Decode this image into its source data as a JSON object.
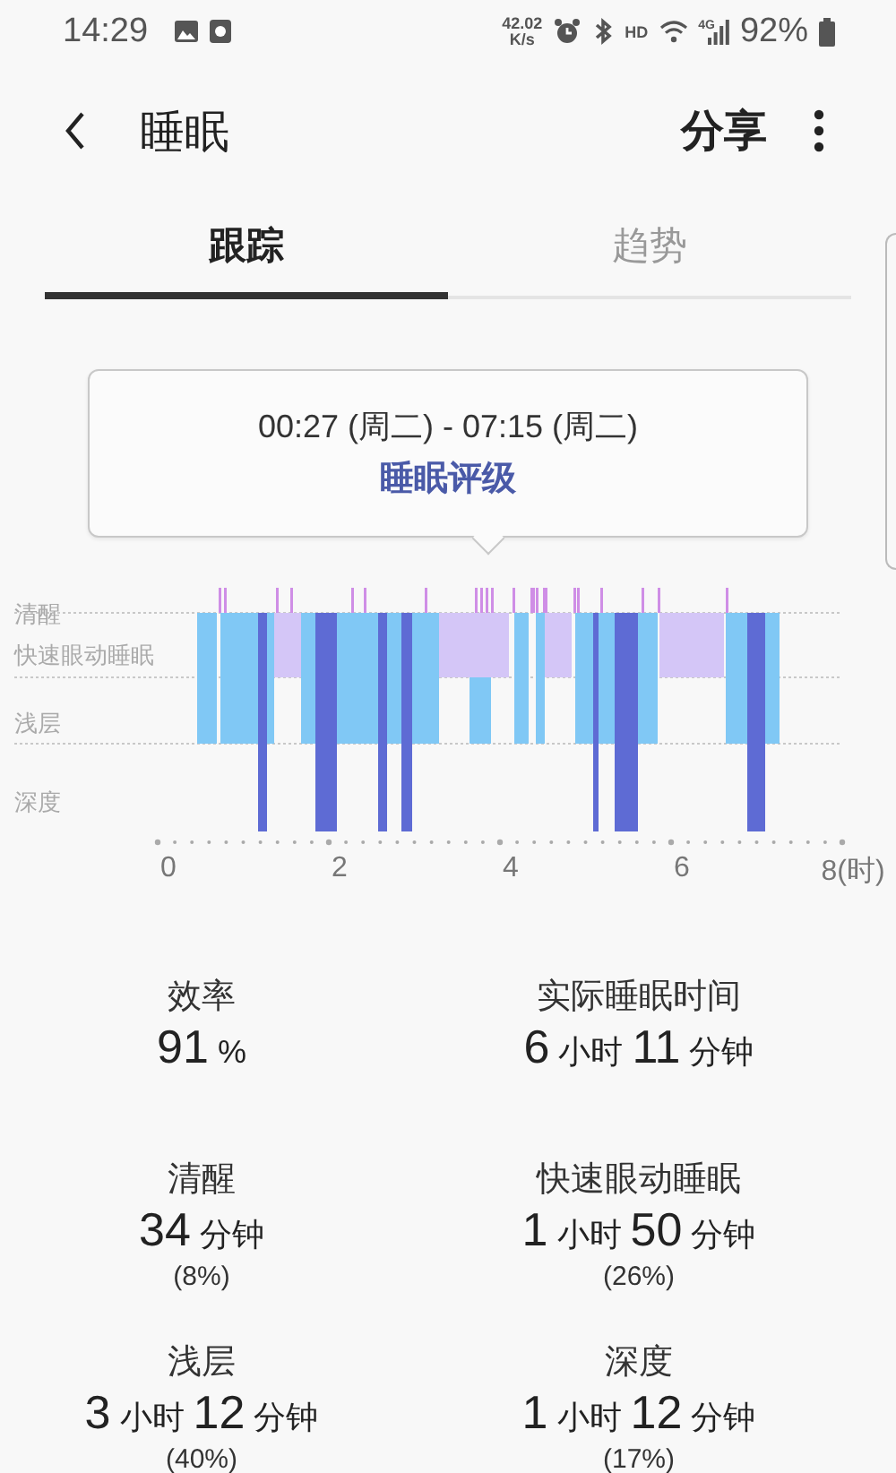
{
  "status_bar": {
    "time": "14:29",
    "net_speed_value": "42.02",
    "net_speed_unit": "K/s",
    "hd": "HD",
    "network": "4G",
    "battery": "92%"
  },
  "app_bar": {
    "title": "睡眠",
    "action": "分享"
  },
  "tabs": [
    {
      "label": "跟踪",
      "selected": true
    },
    {
      "label": "趋势",
      "selected": false
    }
  ],
  "tooltip": {
    "time_range": "00:27 (周二) - 07:15 (周二)",
    "link": "睡眠评级"
  },
  "chart": {
    "stages": [
      "清醒",
      "快速眼动睡眠",
      "浅层",
      "深度"
    ],
    "x_ticks": [
      "0",
      "2",
      "4",
      "6",
      "8(时)"
    ]
  },
  "stats": [
    {
      "label": "效率",
      "value": [
        {
          "kind": "number",
          "text": "91"
        },
        {
          "kind": "unit",
          "text": "%"
        }
      ]
    },
    {
      "label": "实际睡眠时间",
      "value": [
        {
          "kind": "number",
          "text": "6"
        },
        {
          "kind": "unit",
          "text": "小时"
        },
        {
          "kind": "number",
          "text": "11"
        },
        {
          "kind": "unit",
          "text": "分钟"
        }
      ]
    },
    {
      "label": "清醒",
      "value": [
        {
          "kind": "number",
          "text": "34"
        },
        {
          "kind": "unit",
          "text": "分钟"
        }
      ],
      "share": "(8%)"
    },
    {
      "label": "快速眼动睡眠",
      "value": [
        {
          "kind": "number",
          "text": "1"
        },
        {
          "kind": "unit",
          "text": "小时"
        },
        {
          "kind": "number",
          "text": "50"
        },
        {
          "kind": "unit",
          "text": "分钟"
        }
      ],
      "share": "(26%)"
    },
    {
      "label": "浅层",
      "value": [
        {
          "kind": "number",
          "text": "3"
        },
        {
          "kind": "unit",
          "text": "小时"
        },
        {
          "kind": "number",
          "text": "12"
        },
        {
          "kind": "unit",
          "text": "分钟"
        }
      ],
      "share": "(40%)"
    },
    {
      "label": "深度",
      "value": [
        {
          "kind": "number",
          "text": "1"
        },
        {
          "kind": "unit",
          "text": "小时"
        },
        {
          "kind": "number",
          "text": "12"
        },
        {
          "kind": "unit",
          "text": "分钟"
        }
      ],
      "share": "(17%)"
    }
  ]
}
